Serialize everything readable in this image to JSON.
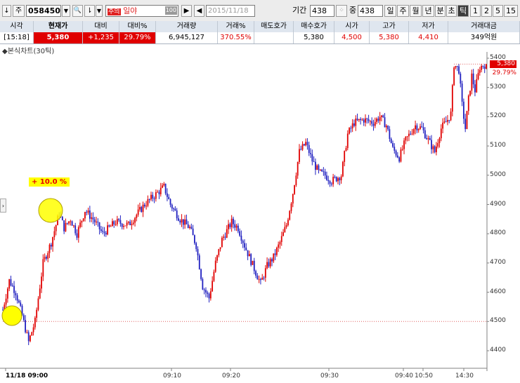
{
  "toolbar": {
    "arrow_glyph": "↓",
    "market_label": "주",
    "stock_code": "058450",
    "search_glyph": "🔍",
    "sort_glyph": "⇂",
    "note_badge": "주의",
    "stock_name": "일야",
    "volume_badge": "100",
    "date": "2015/11/18",
    "period_label": "기간",
    "period_value": "438",
    "zoom_label": "중",
    "zoom_value": "438",
    "period_buttons": [
      "일",
      "주",
      "월",
      "년",
      "분",
      "초",
      "틱",
      "1",
      "2",
      "5",
      "15"
    ],
    "active_period": "틱"
  },
  "quote": {
    "headers": [
      "시각",
      "현재가",
      "대비",
      "대비%",
      "거래량",
      "거래%",
      "매도호가",
      "매수호가",
      "시가",
      "고가",
      "저가",
      "거래대금"
    ],
    "time": "[15:18]",
    "current": "5,380",
    "change": "+1,235",
    "change_pct": "29.79%",
    "volume": "6,945,127",
    "volume_pct": "370.55%",
    "ask": "",
    "bid": "5,380",
    "open": "4,500",
    "high": "5,380",
    "low": "4,410",
    "amount": "349억원"
  },
  "chart_title": "◆본식차트(30틱)",
  "annotation_pct": "+ 10.0 %",
  "price_tag": "5,380",
  "price_tag_pct": "29.79%",
  "colors": {
    "up": "#e00000",
    "down": "#2020c0",
    "marker": "#ffff00"
  },
  "chart_data": {
    "type": "candlestick",
    "y_ticks": [
      4400,
      4500,
      4600,
      4700,
      4800,
      4900,
      5000,
      5100,
      5200,
      5300,
      5400
    ],
    "ylim": [
      4370,
      5410
    ],
    "x_labels": [
      "11/18 09:00",
      "09:10",
      "09:20",
      "09:30",
      "09:40",
      "10:50",
      "14:30"
    ],
    "reference_price": 4500,
    "high_line": 5380,
    "close_path": [
      [
        0,
        4540
      ],
      [
        4,
        4640
      ],
      [
        8,
        4600
      ],
      [
        12,
        4520
      ],
      [
        16,
        4430
      ],
      [
        20,
        4500
      ],
      [
        25,
        4700
      ],
      [
        30,
        4770
      ],
      [
        35,
        4870
      ],
      [
        38,
        4820
      ],
      [
        42,
        4850
      ],
      [
        46,
        4800
      ],
      [
        51,
        4880
      ],
      [
        56,
        4850
      ],
      [
        62,
        4800
      ],
      [
        70,
        4840
      ],
      [
        78,
        4830
      ],
      [
        88,
        4900
      ],
      [
        96,
        4940
      ],
      [
        100,
        4960
      ],
      [
        104,
        4900
      ],
      [
        110,
        4850
      ],
      [
        116,
        4820
      ],
      [
        120,
        4760
      ],
      [
        124,
        4620
      ],
      [
        128,
        4580
      ],
      [
        132,
        4700
      ],
      [
        136,
        4780
      ],
      [
        142,
        4840
      ],
      [
        146,
        4820
      ],
      [
        150,
        4760
      ],
      [
        156,
        4680
      ],
      [
        160,
        4630
      ],
      [
        164,
        4690
      ],
      [
        168,
        4720
      ],
      [
        172,
        4770
      ],
      [
        176,
        4830
      ],
      [
        180,
        4940
      ],
      [
        184,
        5080
      ],
      [
        188,
        5110
      ],
      [
        192,
        5050
      ],
      [
        196,
        5010
      ],
      [
        200,
        5000
      ],
      [
        204,
        4980
      ],
      [
        210,
        5000
      ],
      [
        214,
        5140
      ],
      [
        218,
        5180
      ],
      [
        224,
        5190
      ],
      [
        230,
        5180
      ],
      [
        234,
        5200
      ],
      [
        238,
        5170
      ],
      [
        242,
        5090
      ],
      [
        246,
        5060
      ],
      [
        250,
        5120
      ],
      [
        256,
        5170
      ],
      [
        260,
        5160
      ],
      [
        264,
        5120
      ],
      [
        268,
        5080
      ],
      [
        272,
        5160
      ],
      [
        276,
        5190
      ],
      [
        278,
        5210
      ],
      [
        280,
        5380
      ],
      [
        283,
        5360
      ],
      [
        285,
        5240
      ],
      [
        287,
        5160
      ],
      [
        289,
        5260
      ],
      [
        291,
        5340
      ],
      [
        293,
        5290
      ],
      [
        296,
        5370
      ],
      [
        300,
        5380
      ]
    ]
  }
}
